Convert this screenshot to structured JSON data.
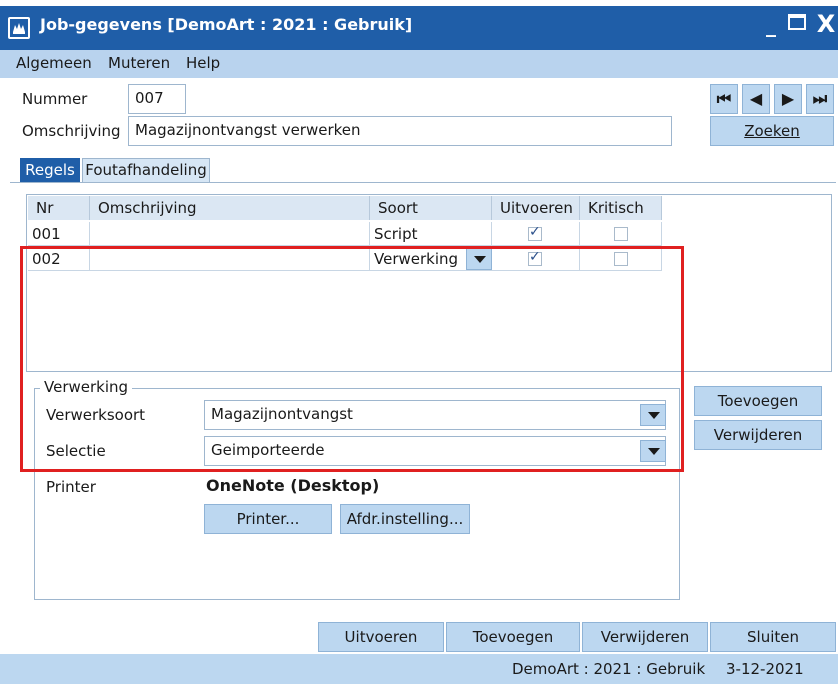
{
  "window": {
    "title": "Job-gegevens  [DemoArt : 2021 : Gebruik]",
    "min": "_",
    "close": "X"
  },
  "menu": {
    "items": [
      "Algemeen",
      "Muteren",
      "Help"
    ]
  },
  "form": {
    "nummer_label": "Nummer",
    "nummer_value": "007",
    "omschrijving_label": "Omschrijving",
    "omschrijving_value": "Magazijnontvangst verwerken"
  },
  "nav": {
    "first": "⏮",
    "prev": "◀",
    "next": "▶",
    "last": "⏭",
    "search": "Zoeken"
  },
  "tabs": [
    {
      "label": "Regels"
    },
    {
      "label": "Foutafhandeling"
    }
  ],
  "grid": {
    "columns": [
      "Nr",
      "Omschrijving",
      "Soort",
      "Uitvoeren",
      "Kritisch"
    ],
    "rows": [
      {
        "nr": "001",
        "omschrijving": "",
        "soort": "Script",
        "uitvoeren": true,
        "kritisch": false
      },
      {
        "nr": "002",
        "omschrijving": "",
        "soort": "Verwerking",
        "uitvoeren": true,
        "kritisch": false
      }
    ]
  },
  "verwerking": {
    "legend": "Verwerking",
    "soort_label": "Verwerksoort",
    "soort_value": "Magazijnontvangst",
    "selectie_label": "Selectie",
    "selectie_value": "Geimporteerde",
    "printer_label": "Printer",
    "printer_value": "OneNote (Desktop)",
    "printer_button": "Printer...",
    "afdr_button": "Afdr.instelling..."
  },
  "side_buttons": {
    "add": "Toevoegen",
    "remove": "Verwijderen"
  },
  "bottom_buttons": {
    "run": "Uitvoeren",
    "add": "Toevoegen",
    "remove": "Verwijderen",
    "close": "Sluiten"
  },
  "status": {
    "context": "DemoArt : 2021 : Gebruik",
    "date": "3-12-2021"
  },
  "colors": {
    "titlebar": "#1f5ea8",
    "button": "#bcd7f0",
    "highlight": "#e02020"
  }
}
